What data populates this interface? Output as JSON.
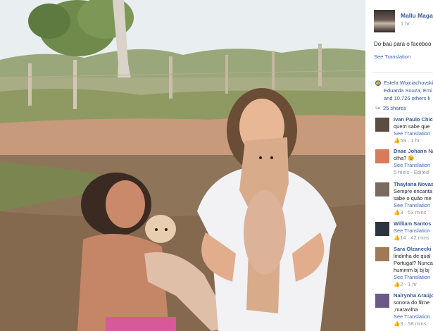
{
  "post": {
    "author": "Mallu Magal",
    "time": "1 hr ·",
    "text": "Do baú para o faceboo",
    "see_translation": "See Translation"
  },
  "reactions": {
    "line1": "Estela Wojciachovski,",
    "line2": "Eduarda Souza, Emi",
    "line3": "and 10.726 others li"
  },
  "shares": "25 shares",
  "comments": [
    {
      "name": "Ivan Paulo Chic",
      "text": "quem sabe que",
      "translation": "See Translation",
      "meta": "59 · 1 hr",
      "avatar_color": "#5c4d43"
    },
    {
      "name": "Dnae Johann",
      "name_suffix": "Na",
      "text": "olha? 😉",
      "translation": "See Translation",
      "meta": "5 mins · Edited",
      "avatar_color": "#d97a5b"
    },
    {
      "name": "Thaylana Novas",
      "text": "Sempre encanta",
      "text2": "sabe o quão me",
      "translation": "See Translation",
      "meta": "3 · 53 mins",
      "avatar_color": "#7a6a60"
    },
    {
      "name": "William Santos",
      "text": "",
      "translation": "See Translation",
      "meta": "14 · 42 mins",
      "avatar_color": "#2e3340"
    },
    {
      "name": "Sara Olzanecki",
      "text": "lindinha de qual",
      "text2": "Portugal? Nunca",
      "text3": "hummm bj bj bj",
      "translation": "See Translation",
      "meta": "2 · 1 hr",
      "avatar_color": "#a07a55"
    },
    {
      "name": "Nalrynha Araújo",
      "text": "sonora do filme",
      "text2": ",maravilha",
      "translation": "See Translation",
      "meta": "3 · 58 mins",
      "avatar_color": "#6a5a8a"
    }
  ],
  "colors": {
    "link": "#365899",
    "accent": "#4267b2",
    "muted": "#90949c"
  }
}
